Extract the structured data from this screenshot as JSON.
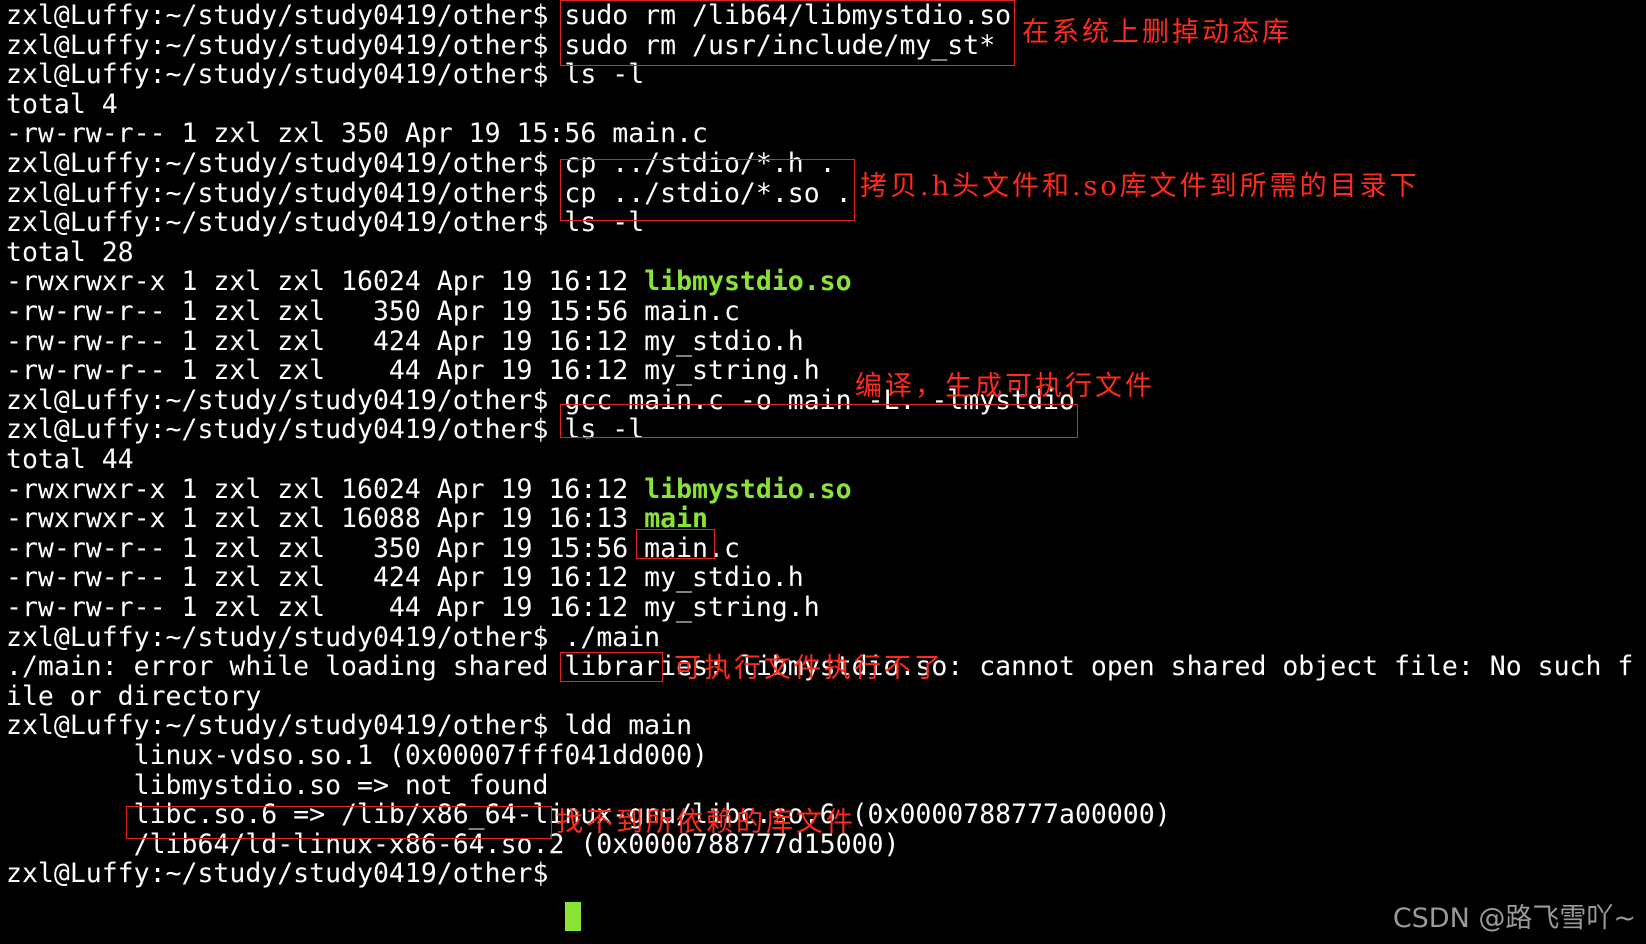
{
  "terminal": {
    "lines": [
      {
        "prompt": "zxl@Luffy:~/study/study0419/other$ ",
        "cmd": "sudo rm /lib64/libmystdio.so"
      },
      {
        "prompt": "zxl@Luffy:~/study/study0419/other$ ",
        "cmd": "sudo rm /usr/include/my_st*"
      },
      {
        "prompt": "zxl@Luffy:~/study/study0419/other$ ",
        "cmd": "ls -l"
      },
      {
        "text": "total 4"
      },
      {
        "text": "-rw-rw-r-- 1 zxl zxl 350 Apr 19 15:56 main.c"
      },
      {
        "prompt": "zxl@Luffy:~/study/study0419/other$ ",
        "cmd": "cp ../stdio/*.h ."
      },
      {
        "prompt": "zxl@Luffy:~/study/study0419/other$ ",
        "cmd": "cp ../stdio/*.so ."
      },
      {
        "prompt": "zxl@Luffy:~/study/study0419/other$ ",
        "cmd": "ls -l"
      },
      {
        "text": "total 28"
      },
      {
        "text": "-rwxrwxr-x 1 zxl zxl 16024 Apr 19 16:12 ",
        "exec": "libmystdio.so"
      },
      {
        "text": "-rw-rw-r-- 1 zxl zxl   350 Apr 19 15:56 main.c"
      },
      {
        "text": "-rw-rw-r-- 1 zxl zxl   424 Apr 19 16:12 my_stdio.h"
      },
      {
        "text": "-rw-rw-r-- 1 zxl zxl    44 Apr 19 16:12 my_string.h"
      },
      {
        "prompt": "zxl@Luffy:~/study/study0419/other$ ",
        "cmd": "gcc main.c -o main -L. -lmystdio"
      },
      {
        "prompt": "zxl@Luffy:~/study/study0419/other$ ",
        "cmd": "ls -l"
      },
      {
        "text": "total 44"
      },
      {
        "text": "-rwxrwxr-x 1 zxl zxl 16024 Apr 19 16:12 ",
        "exec": "libmystdio.so"
      },
      {
        "text": "-rwxrwxr-x 1 zxl zxl 16088 Apr 19 16:13 ",
        "exec": "main"
      },
      {
        "text": "-rw-rw-r-- 1 zxl zxl   350 Apr 19 15:56 main.c"
      },
      {
        "text": "-rw-rw-r-- 1 zxl zxl   424 Apr 19 16:12 my_stdio.h"
      },
      {
        "text": "-rw-rw-r-- 1 zxl zxl    44 Apr 19 16:12 my_string.h"
      },
      {
        "prompt": "zxl@Luffy:~/study/study0419/other$ ",
        "cmd": "./main"
      },
      {
        "text": "./main: error while loading shared libraries: libmystdio.so: cannot open shared object file: No such f"
      },
      {
        "text": "ile or directory"
      },
      {
        "prompt": "zxl@Luffy:~/study/study0419/other$ ",
        "cmd": "ldd main"
      },
      {
        "text": "        linux-vdso.so.1 (0x00007fff041dd000)"
      },
      {
        "text": "        libmystdio.so => not found"
      },
      {
        "text": "        libc.so.6 => /lib/x86_64-linux-gnu/libc.so.6 (0x0000788777a00000)"
      },
      {
        "text": "        /lib64/ld-linux-x86-64.so.2 (0x0000788777d15000)"
      },
      {
        "prompt": "zxl@Luffy:~/study/study0419/other$ ",
        "cmd": ""
      }
    ]
  },
  "annotations": {
    "delete_lib": "在系统上删掉动态库",
    "copy_files": "拷贝.h头文件和.so库文件到所需的目录下",
    "compile": "编译，生成可执行文件",
    "cannot_run": "可执行文件执行不了",
    "not_found": "找不到所依赖的库文件"
  },
  "watermark": "CSDN @路飞雪吖~",
  "colors": {
    "background": "#000000",
    "foreground": "#ffffff",
    "executable": "#8ae234",
    "annotation": "#ff2a1a"
  }
}
